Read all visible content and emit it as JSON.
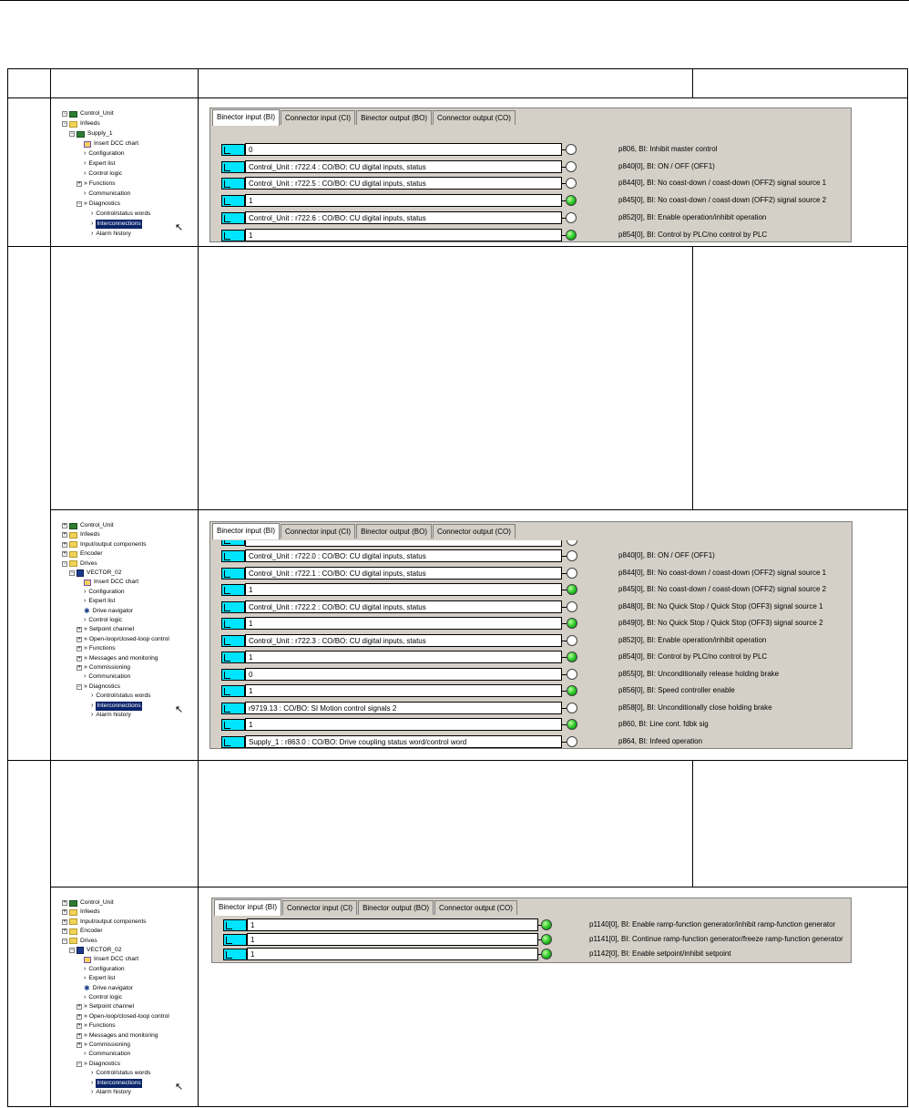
{
  "tab_labels": [
    "Binector input (BI)",
    "Connector input (CI)",
    "Binector output (BO)",
    "Connector output (CO)"
  ],
  "tree1": [
    {
      "label": "Control_Unit",
      "icon": "control-unit-icon",
      "expander": "-"
    },
    {
      "label": "Infeeds",
      "icon": "folder-icon",
      "expander": "-"
    },
    {
      "label": "Supply_1",
      "icon": "supply-icon",
      "expander": "-"
    },
    {
      "label": "Insert DCC chart",
      "icon": "dcc-chart-icon",
      "expander": ""
    },
    {
      "label": "Configuration",
      "icon": "chevron-icon",
      "expander": ""
    },
    {
      "label": "Expert list",
      "icon": "chevron-icon",
      "expander": ""
    },
    {
      "label": "Control logic",
      "icon": "chevron-icon",
      "expander": ""
    },
    {
      "label": "Functions",
      "icon": "double-chevron-icon",
      "expander": "+"
    },
    {
      "label": "Communication",
      "icon": "chevron-icon",
      "expander": ""
    },
    {
      "label": "Diagnostics",
      "icon": "double-chevron-icon",
      "expander": "-"
    },
    {
      "label": "Control/status words",
      "icon": "chevron-icon",
      "expander": ""
    },
    {
      "label": "Interconnections",
      "icon": "chevron-icon",
      "expander": "",
      "selected": true
    },
    {
      "label": "Alarm history",
      "icon": "chevron-icon",
      "expander": ""
    }
  ],
  "panel1_rows": [
    {
      "value": "0",
      "led": "off",
      "param": "p806, BI: Inhibit master control"
    },
    {
      "value": "Control_Unit : r722.4 : CO/BO: CU digital inputs, status",
      "led": "off",
      "param": "p840[0], BI: ON / OFF (OFF1)"
    },
    {
      "value": "Control_Unit : r722.5 : CO/BO: CU digital inputs, status",
      "led": "off",
      "param": "p844[0], BI: No coast-down / coast-down (OFF2) signal source 1"
    },
    {
      "value": "1",
      "led": "on",
      "param": "p845[0], BI: No coast-down / coast-down (OFF2) signal source 2"
    },
    {
      "value": "Control_Unit : r722.6 : CO/BO: CU digital inputs, status",
      "led": "off",
      "param": "p852[0], BI: Enable operation/inhibit operation"
    },
    {
      "value": "1",
      "led": "on",
      "param": "p854[0], BI: Control by PLC/no control by PLC"
    }
  ],
  "tree_drive": [
    {
      "label": "Control_Unit",
      "icon": "control-unit-icon",
      "expander": "+"
    },
    {
      "label": "Infeeds",
      "icon": "folder-icon",
      "expander": "+"
    },
    {
      "label": "Input/output components",
      "icon": "folder-icon",
      "expander": "+"
    },
    {
      "label": "Encoder",
      "icon": "folder-icon",
      "expander": "+"
    },
    {
      "label": "Drives",
      "icon": "folder-icon",
      "expander": "-"
    },
    {
      "label": "VECTOR_02",
      "icon": "drive-icon",
      "expander": "-"
    },
    {
      "label": "Insert DCC chart",
      "icon": "dcc-chart-icon",
      "expander": ""
    },
    {
      "label": "Configuration",
      "icon": "chevron-icon",
      "expander": ""
    },
    {
      "label": "Expert list",
      "icon": "chevron-icon",
      "expander": ""
    },
    {
      "label": "Drive navigator",
      "icon": "drive-navigator-icon",
      "expander": ""
    },
    {
      "label": "Control logic",
      "icon": "chevron-icon",
      "expander": ""
    },
    {
      "label": "Setpoint channel",
      "icon": "double-chevron-icon",
      "expander": "+"
    },
    {
      "label": "Open-loop/closed-loop control",
      "icon": "double-chevron-icon",
      "expander": "+"
    },
    {
      "label": "Functions",
      "icon": "double-chevron-icon",
      "expander": "+"
    },
    {
      "label": "Messages and monitoring",
      "icon": "double-chevron-icon",
      "expander": "+"
    },
    {
      "label": "Commissioning",
      "icon": "double-chevron-icon",
      "expander": "+"
    },
    {
      "label": "Communication",
      "icon": "chevron-icon",
      "expander": ""
    },
    {
      "label": "Diagnostics",
      "icon": "double-chevron-icon",
      "expander": "-"
    },
    {
      "label": "Control/status words",
      "icon": "chevron-icon",
      "expander": ""
    },
    {
      "label": "Interconnections",
      "icon": "chevron-icon",
      "expander": "",
      "selected": true
    },
    {
      "label": "Alarm history",
      "icon": "chevron-icon",
      "expander": ""
    }
  ],
  "panel2_rows": [
    {
      "value": "Control_Unit : r722.0 : CO/BO: CU digital inputs, status",
      "led": "off",
      "param": "p840[0], BI: ON / OFF (OFF1)"
    },
    {
      "value": "Control_Unit : r722.1 : CO/BO: CU digital inputs, status",
      "led": "off",
      "param": "p844[0], BI: No coast-down / coast-down (OFF2) signal source 1"
    },
    {
      "value": "1",
      "led": "on",
      "param": "p845[0], BI: No coast-down / coast-down (OFF2) signal source 2"
    },
    {
      "value": "Control_Unit : r722.2 : CO/BO: CU digital inputs, status",
      "led": "off",
      "param": "p848[0], BI: No Quick Stop / Quick Stop (OFF3) signal source 1"
    },
    {
      "value": "1",
      "led": "on",
      "param": "p849[0], BI: No Quick Stop / Quick Stop (OFF3) signal source 2"
    },
    {
      "value": "Control_Unit : r722.3 : CO/BO: CU digital inputs, status",
      "led": "off",
      "param": "p852[0], BI: Enable operation/inhibit operation"
    },
    {
      "value": "1",
      "led": "on",
      "param": "p854[0], BI: Control by PLC/no control by PLC"
    },
    {
      "value": "0",
      "led": "off",
      "param": "p855[0], BI: Unconditionally release holding brake"
    },
    {
      "value": "1",
      "led": "on",
      "param": "p856[0], BI: Speed controller enable"
    },
    {
      "value": "r9719.13 : CO/BO: SI Motion control signals 2",
      "led": "off",
      "param": "p858[0], BI: Unconditionally close holding brake"
    },
    {
      "value": "1",
      "led": "on",
      "param": "p860, BI: Line cont. fdbk sig"
    },
    {
      "value": "Supply_1 : r863.0 : CO/BO: Drive coupling status word/control word",
      "led": "off",
      "param": "p864, BI: Infeed operation"
    }
  ],
  "panel3_rows": [
    {
      "value": "1",
      "led": "on",
      "param": "p1140[0], BI: Enable ramp-function generator/inhibit ramp-function generator"
    },
    {
      "value": "1",
      "led": "on",
      "param": "p1141[0], BI: Continue ramp-function generator/freeze ramp-function generator"
    },
    {
      "value": "1",
      "led": "on",
      "param": "p1142[0], BI: Enable setpoint/inhibit setpoint"
    }
  ]
}
